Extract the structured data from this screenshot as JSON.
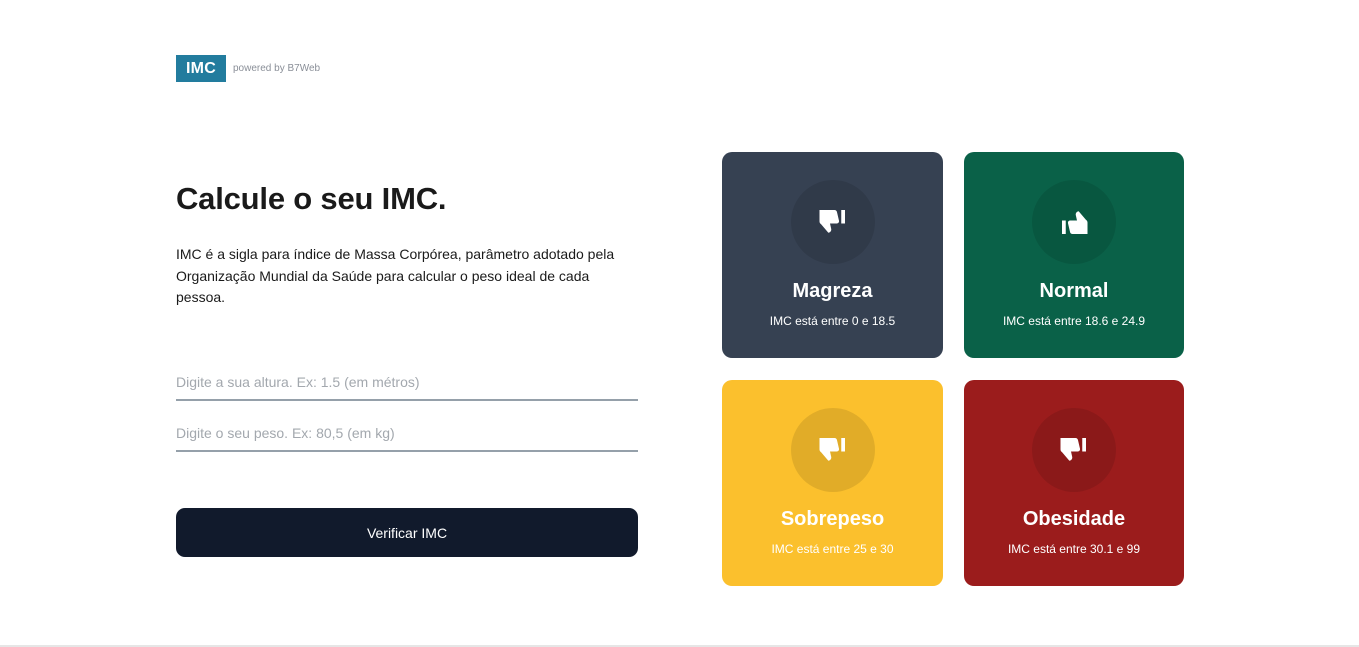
{
  "header": {
    "logo_text": "IMC",
    "powered_by": "powered by B7Web"
  },
  "main": {
    "title": "Calcule o seu IMC.",
    "description": "IMC é a sigla para índice de Massa Corpórea, parâmetro adotado pela Organização Mundial da Saúde para calcular o peso ideal de cada pessoa.",
    "height_input": {
      "value": "",
      "placeholder": "Digite a sua altura. Ex: 1.5 (em métros)"
    },
    "weight_input": {
      "value": "",
      "placeholder": "Digite o seu peso. Ex: 80,5 (em kg)"
    },
    "verify_button": "Verificar IMC"
  },
  "colors": {
    "logo": "#227c9e",
    "button": "#111a2c",
    "magreza": "#364152",
    "normal": "#0a6148",
    "sobrepeso": "#fbc02d",
    "obesidade": "#9b1c1c"
  },
  "cards": [
    {
      "title": "Magreza",
      "range": "IMC está entre 0 e 18.5",
      "icon": "thumbs-down-icon",
      "color": "#364152"
    },
    {
      "title": "Normal",
      "range": "IMC está entre 18.6 e 24.9",
      "icon": "thumbs-up-icon",
      "color": "#0a6148"
    },
    {
      "title": "Sobrepeso",
      "range": "IMC está entre 25 e 30",
      "icon": "thumbs-down-icon",
      "color": "#fbc02d"
    },
    {
      "title": "Obesidade",
      "range": "IMC está entre 30.1 e 99",
      "icon": "thumbs-down-icon",
      "color": "#9b1c1c"
    }
  ]
}
